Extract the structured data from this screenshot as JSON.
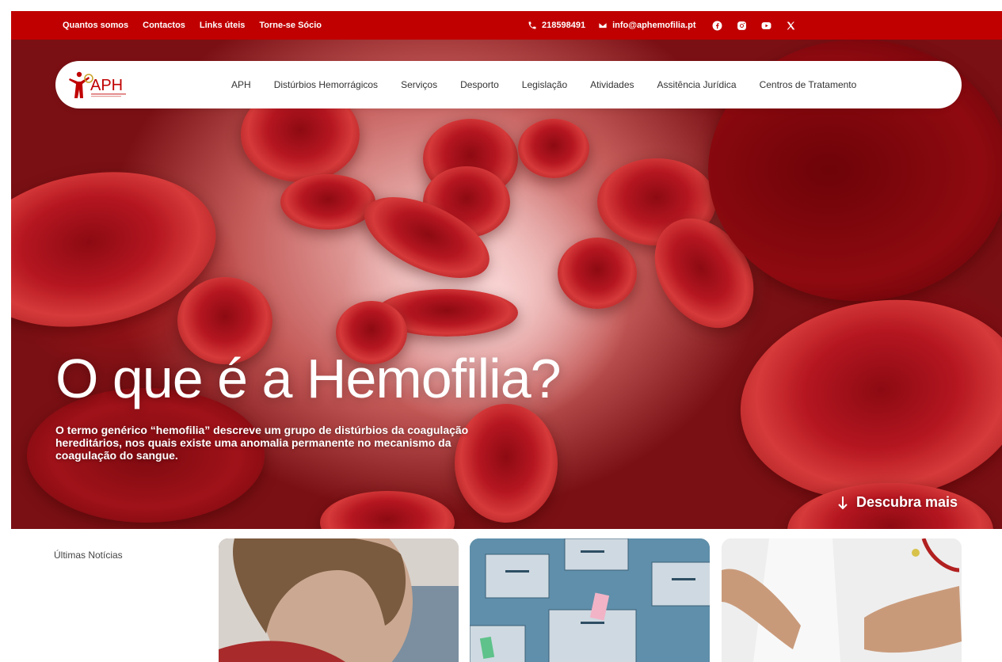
{
  "topbar": {
    "links": [
      "Quantos somos",
      "Contactos",
      "Links úteis",
      "Torne-se Sócio"
    ],
    "phone": "218598491",
    "email": "info@aphemofilia.pt",
    "social_icons": [
      "facebook-icon",
      "instagram-icon",
      "youtube-icon",
      "x-icon"
    ],
    "bg_color": "#c00000"
  },
  "logo": {
    "text": "APH"
  },
  "nav": {
    "items": [
      "APH",
      "Distúrbios Hemorrágicos",
      "Serviços",
      "Desporto",
      "Legislação",
      "Atividades",
      "Assitência Jurídica",
      "Centros de Tratamento"
    ]
  },
  "hero": {
    "title": "O que é a Hemofilia?",
    "text": "O termo genérico “hemofilia” descreve um grupo de distúrbios da coagulação hereditários, nos quais existe uma anomalia permanente no mecanismo da coagulação do sangue.",
    "cta": "Descubra mais"
  },
  "news": {
    "label": "Últimas Notícias"
  }
}
